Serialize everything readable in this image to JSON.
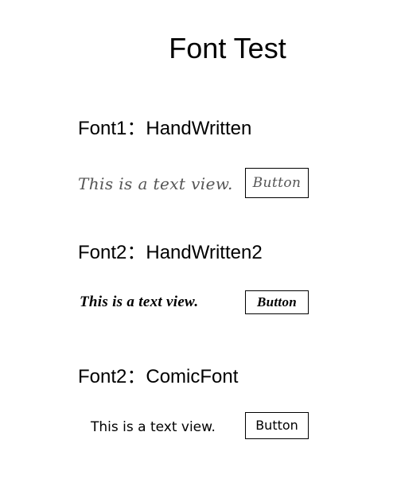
{
  "page": {
    "title": "Font Test"
  },
  "sections": [
    {
      "heading": "Font1：HandWritten",
      "text_view": "This is a text view.",
      "button_label": "Button"
    },
    {
      "heading": "Font2：HandWritten2",
      "text_view": "This is a text view.",
      "button_label": "Button"
    },
    {
      "heading": "Font2：ComicFont",
      "text_view": "This is a text view.",
      "button_label": "Button"
    }
  ],
  "colors": {
    "background": "#ffffff",
    "text": "#000000",
    "handwritten_text": "#555555",
    "button_border": "#000000"
  }
}
